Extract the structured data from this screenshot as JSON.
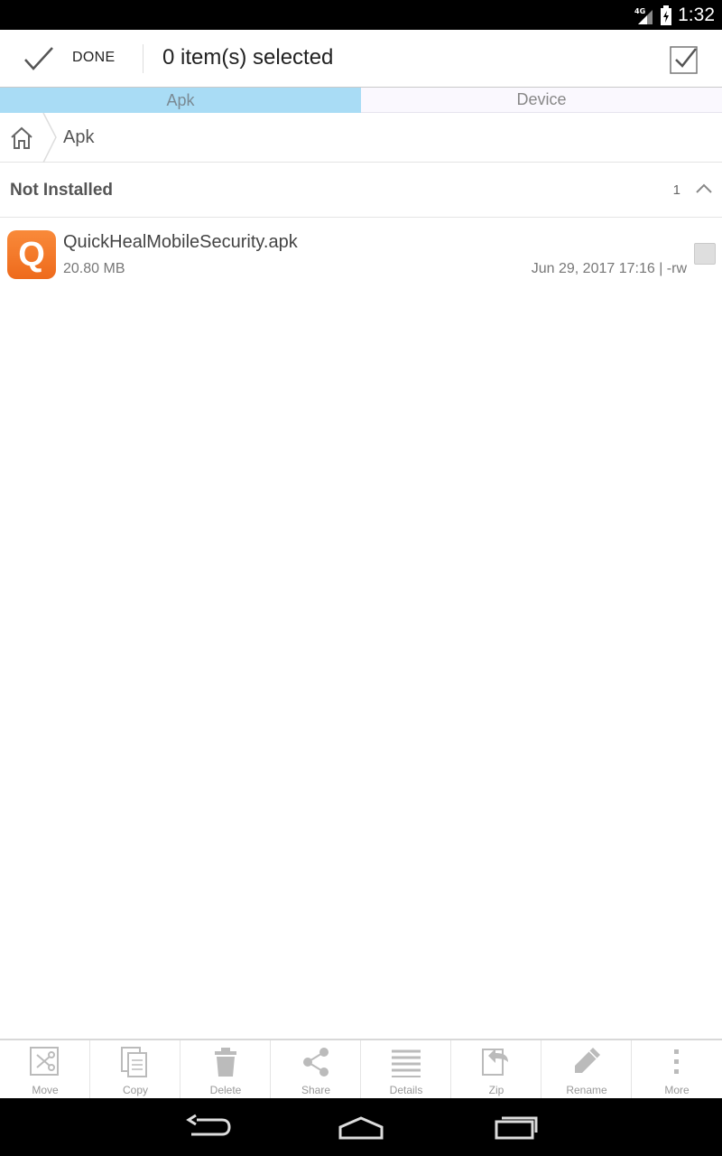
{
  "status_bar": {
    "network": "4G",
    "time": "1:32"
  },
  "action_bar": {
    "done_label": "DONE",
    "selection_title": "0 item(s) selected"
  },
  "tabs": [
    {
      "label": "Apk",
      "active": true
    },
    {
      "label": "Device",
      "active": false
    }
  ],
  "breadcrumb": {
    "current": "Apk"
  },
  "group": {
    "title": "Not Installed",
    "count": "1"
  },
  "files": [
    {
      "icon_letter": "Q",
      "name": "QuickHealMobileSecurity.apk",
      "size": "20.80 MB",
      "meta": "Jun 29, 2017 17:16 | -rw",
      "checked": false
    }
  ],
  "toolbar": {
    "move": "Move",
    "copy": "Copy",
    "delete": "Delete",
    "share": "Share",
    "details": "Details",
    "zip": "Zip",
    "rename": "Rename",
    "more": "More"
  },
  "colors": {
    "accent_tab": "#a9dcf5",
    "app_icon": "#f47a2a"
  }
}
